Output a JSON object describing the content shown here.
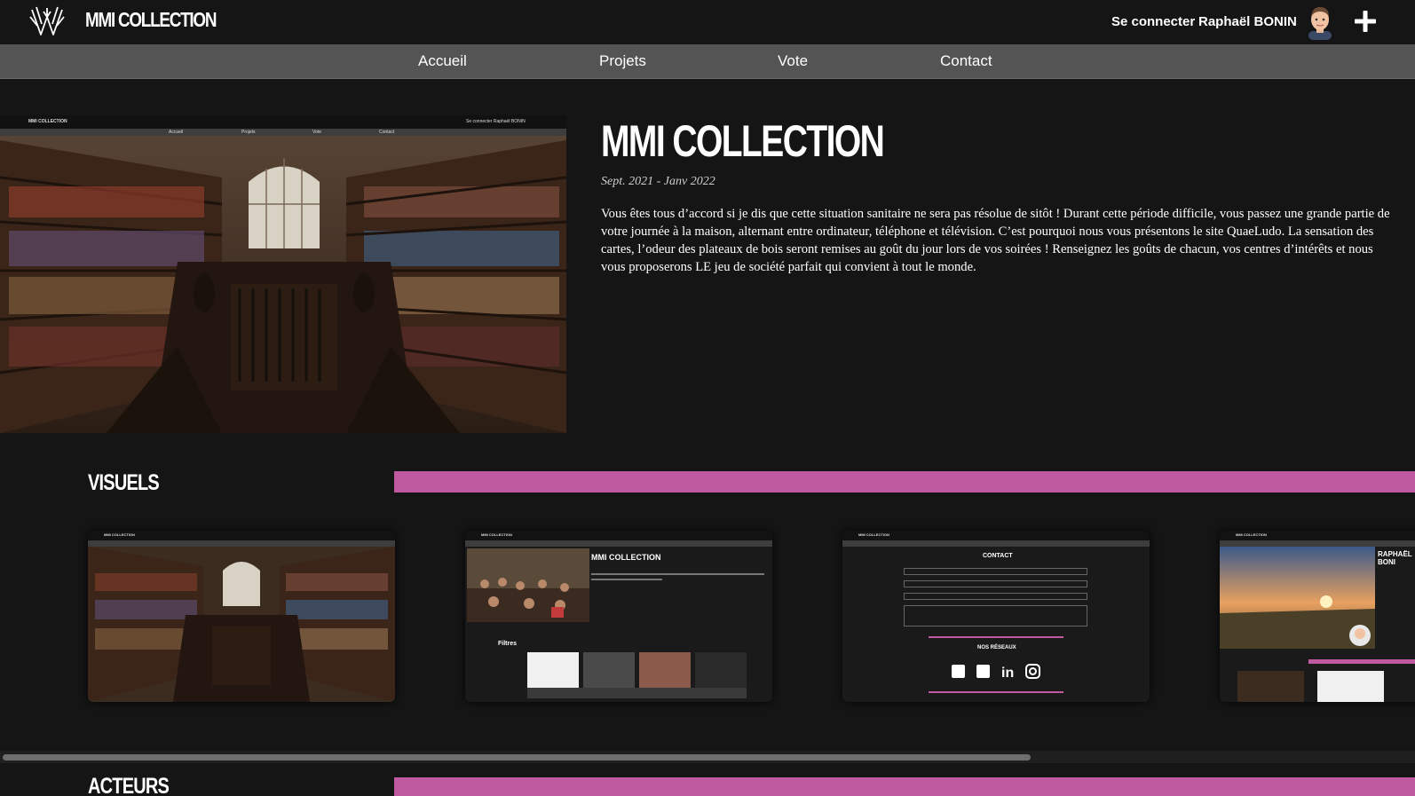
{
  "header": {
    "brand": "MMI COLLECTION",
    "login_label": "Se connecter",
    "username": "Raphaël BONIN"
  },
  "nav": {
    "items": [
      "Accueil",
      "Projets",
      "Vote",
      "Contact"
    ]
  },
  "project": {
    "title": "MMI COLLECTION",
    "date": "Sept. 2021 - Janv 2022",
    "description": "Vous êtes tous d’accord si je dis que cette situation sanitaire ne sera pas résolue de sitôt ! Durant cette période difficile, vous passez une grande partie de votre journée à la maison, alternant entre ordinateur, téléphone et télévision. C’est pourquoi nous vous présentons le site QuaeLudo. La sensation des cartes, l’odeur des plateaux de bois seront remises au goût du jour lors de vos soirées ! Renseignez les goûts de chacun, vos centres d’intérêts et nous vous proposerons LE jeu de société parfait qui convient à tout le monde."
  },
  "sections": {
    "visuels": "VISUELS",
    "acteurs": "ACTEURS"
  },
  "thumbnails": {
    "brand": "MMI COLLECTION",
    "login_user": "Se connecter Raphaël BONIN",
    "thumb2_title": "MMI COLLECTION",
    "thumb2_filters": "Filtres",
    "thumb3_title": "CONTACT",
    "thumb3_networks": "NOS RÉSEAUX",
    "thumb4_name": "RAPHAËL BONI"
  },
  "colors": {
    "background": "#151515",
    "nav": "#545454",
    "accent_pink": "#c05aa0"
  }
}
